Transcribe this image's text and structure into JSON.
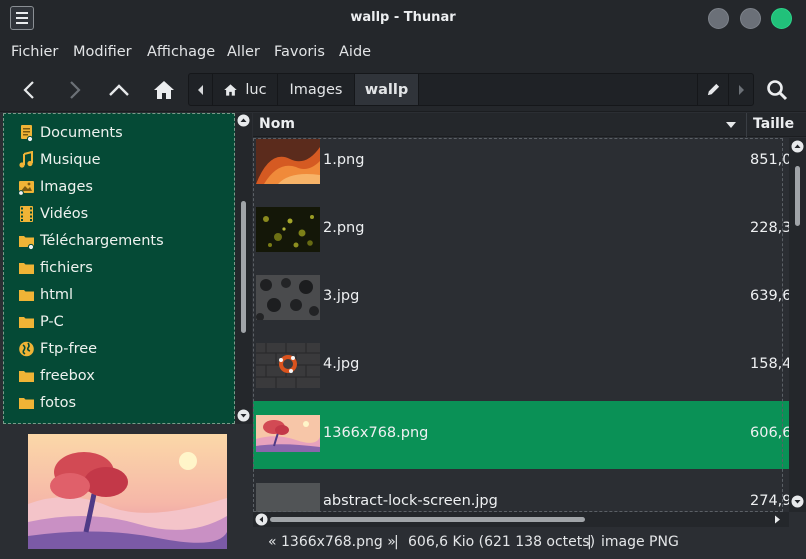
{
  "window": {
    "title": "wallp - Thunar"
  },
  "menu": [
    "Fichier",
    "Modifier",
    "Affichage",
    "Aller",
    "Favoris",
    "Aide"
  ],
  "pathbar": {
    "segments": [
      "luc",
      "Images",
      "wallp"
    ],
    "active": "wallp"
  },
  "sidebar": {
    "items": [
      {
        "label": "Documents",
        "icon": "documents-folder-icon"
      },
      {
        "label": "Musique",
        "icon": "music-note-icon"
      },
      {
        "label": "Images",
        "icon": "pictures-folder-icon"
      },
      {
        "label": "Vidéos",
        "icon": "film-icon"
      },
      {
        "label": "Téléchargements",
        "icon": "downloads-folder-icon"
      },
      {
        "label": "fichiers",
        "icon": "folder-icon"
      },
      {
        "label": "html",
        "icon": "folder-icon"
      },
      {
        "label": "P-C",
        "icon": "folder-icon"
      },
      {
        "label": "Ftp-free",
        "icon": "network-globe-icon"
      },
      {
        "label": "freebox",
        "icon": "folder-icon"
      },
      {
        "label": "fotos",
        "icon": "folder-icon"
      }
    ]
  },
  "list": {
    "headers": {
      "name": "Nom",
      "size": "Taille"
    },
    "rows": [
      {
        "name": "1.png",
        "size": "851,0",
        "selected": false
      },
      {
        "name": "2.png",
        "size": "228,3",
        "selected": false
      },
      {
        "name": "3.jpg",
        "size": "639,6",
        "selected": false
      },
      {
        "name": "4.jpg",
        "size": "158,4",
        "selected": false
      },
      {
        "name": "1366x768.png",
        "size": "606,6",
        "selected": true
      },
      {
        "name": "abstract-lock-screen.jpg",
        "size": "274,9",
        "selected": false
      }
    ]
  },
  "status": {
    "filename": "« 1366x768.png »",
    "sep": "|",
    "size": "606,6 Kio (621 138 octets)",
    "type": "image PNG"
  },
  "colors": {
    "selection": "#0a9156",
    "sidebar_bg": "#054a36",
    "folder": "#f0b436",
    "close": "#21c17a",
    "window_button": "#6b7078"
  }
}
